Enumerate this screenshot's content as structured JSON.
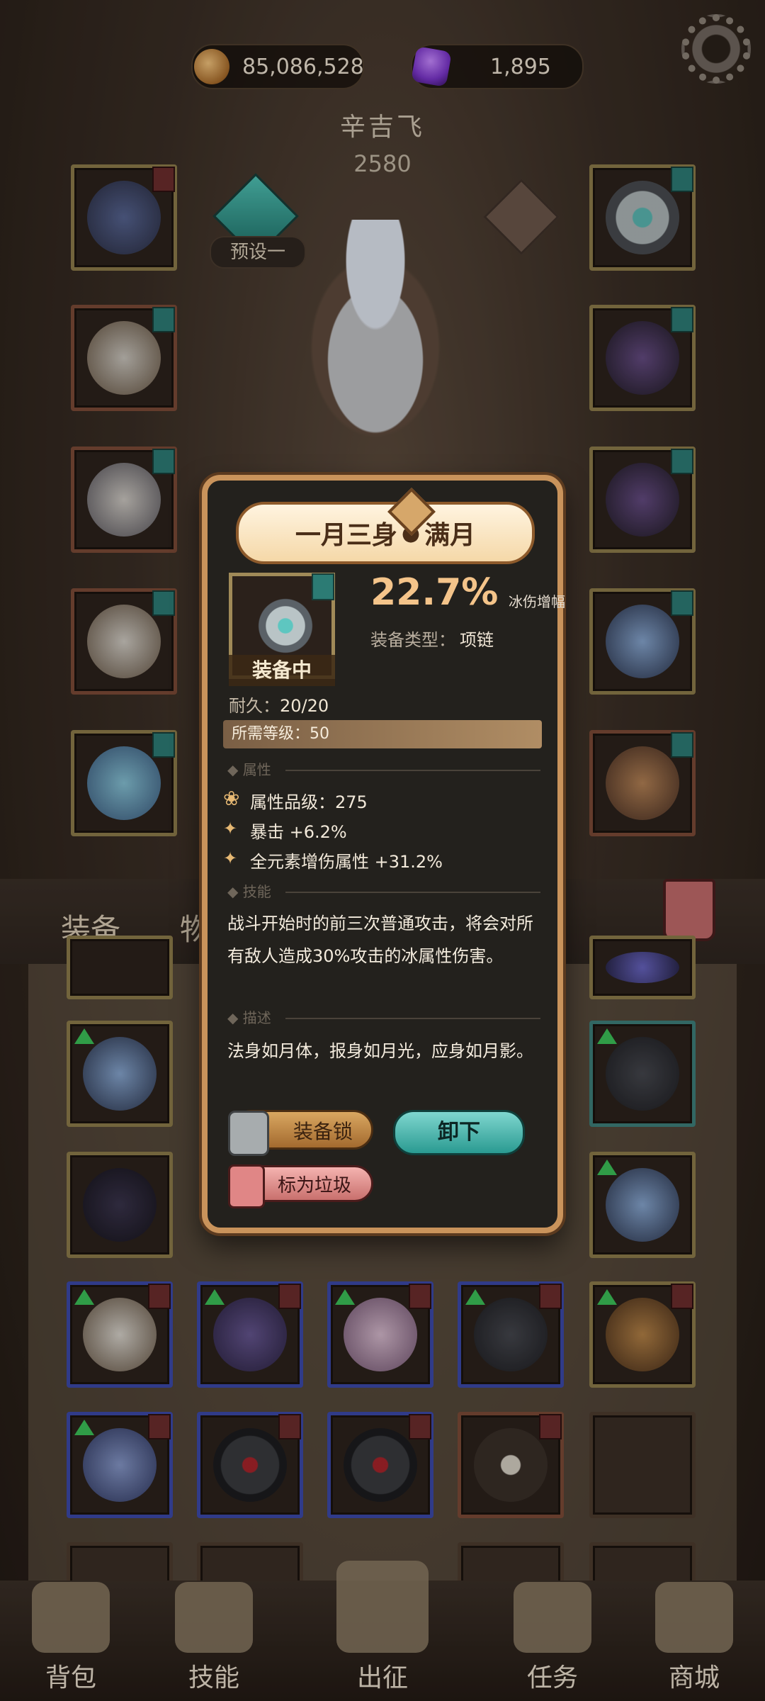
{
  "currency": {
    "gold": "85,086,528",
    "gems": "1,895"
  },
  "hero": {
    "name": "辛吉飞",
    "power": "2580",
    "preset_label": "预设一"
  },
  "inventory": {
    "tab_equipment": "装备",
    "tab_items": "物"
  },
  "modal": {
    "title_left": "一月三身",
    "title_right": "满月",
    "equipped_label": "装备中",
    "bonus_value": "22.7%",
    "bonus_label": "冰伤增幅",
    "type_label": "装备类型：",
    "type_value": "项链",
    "durability_label": "耐久：",
    "durability_value": "20/20",
    "required_level": "所需等级：50",
    "section_attributes": "属性",
    "stat_grade": "属性品级：275",
    "stat_crit": "暴击 +6.2%",
    "stat_elemental": "全元素增伤属性 +31.2%",
    "section_skill": "技能",
    "skill_text": "战斗开始时的前三次普通攻击，将会对所有敌人造成30%攻击的冰属性伤害。",
    "section_desc": "描述",
    "desc_text": "法身如月体，报身如月光，应身如月影。",
    "lock_button": "装备锁",
    "unequip_button": "卸下",
    "junk_button": "标为垃圾"
  },
  "nav": {
    "bag": "背包",
    "skills": "技能",
    "battle": "出征",
    "quests": "任务",
    "shop": "商城"
  },
  "colors": {
    "modal_border": "#c9935b",
    "unequip_btn": "#2a9a91",
    "percent_text": "#f4c48a"
  }
}
